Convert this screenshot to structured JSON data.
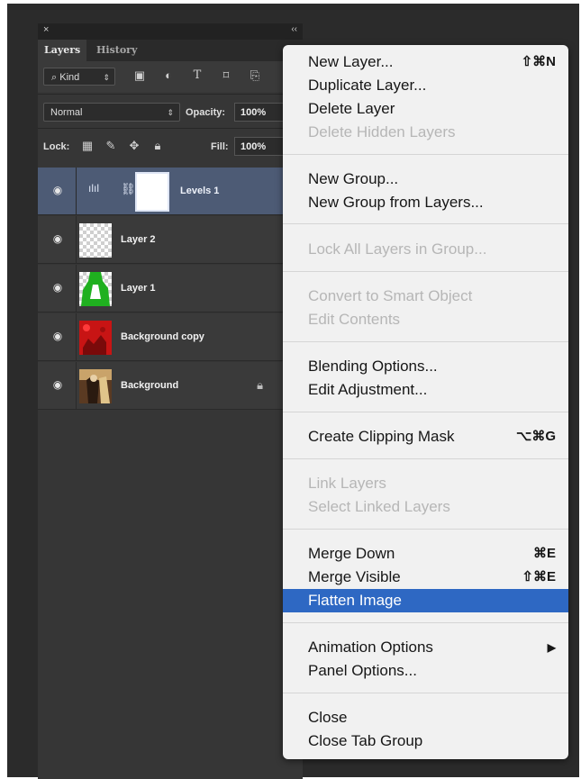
{
  "panel": {
    "close_glyph": "×",
    "collapse_glyph": "‹‹",
    "tabs": [
      {
        "label": "Layers",
        "active": true
      },
      {
        "label": "History",
        "active": false
      }
    ],
    "filter": {
      "kind_label": "Kind",
      "search_glyph": "⌕"
    },
    "blend_mode": "Normal",
    "opacity_label": "Opacity:",
    "opacity_value": "100%",
    "lock_label": "Lock:",
    "fill_label": "Fill:",
    "fill_value": "100%",
    "layers": [
      {
        "name": "Levels 1",
        "type": "adjustment",
        "selected": true,
        "visible": true
      },
      {
        "name": "Layer 2",
        "type": "transparent",
        "selected": false,
        "visible": true
      },
      {
        "name": "Layer 1",
        "type": "green",
        "selected": false,
        "visible": true
      },
      {
        "name": "Background copy",
        "type": "red",
        "selected": false,
        "visible": true
      },
      {
        "name": "Background",
        "type": "photo",
        "selected": false,
        "visible": true,
        "locked": true
      }
    ]
  },
  "menu": {
    "items": [
      {
        "label": "New Layer...",
        "shortcut": "⇧⌘N",
        "enabled": true
      },
      {
        "label": "Duplicate Layer...",
        "shortcut": "",
        "enabled": true
      },
      {
        "label": "Delete Layer",
        "shortcut": "",
        "enabled": true
      },
      {
        "label": "Delete Hidden Layers",
        "shortcut": "",
        "enabled": false
      },
      {
        "label": "New Group...",
        "shortcut": "",
        "enabled": true
      },
      {
        "label": "New Group from Layers...",
        "shortcut": "",
        "enabled": true
      },
      {
        "label": "Lock All Layers in Group...",
        "shortcut": "",
        "enabled": false
      },
      {
        "label": "Convert to Smart Object",
        "shortcut": "",
        "enabled": false
      },
      {
        "label": "Edit Contents",
        "shortcut": "",
        "enabled": false
      },
      {
        "label": "Blending Options...",
        "shortcut": "",
        "enabled": true
      },
      {
        "label": "Edit Adjustment...",
        "shortcut": "",
        "enabled": true
      },
      {
        "label": "Create Clipping Mask",
        "shortcut": "⌥⌘G",
        "enabled": true
      },
      {
        "label": "Link Layers",
        "shortcut": "",
        "enabled": false
      },
      {
        "label": "Select Linked Layers",
        "shortcut": "",
        "enabled": false
      },
      {
        "label": "Merge Down",
        "shortcut": "⌘E",
        "enabled": true
      },
      {
        "label": "Merge Visible",
        "shortcut": "⇧⌘E",
        "enabled": true
      },
      {
        "label": "Flatten Image",
        "shortcut": "",
        "enabled": true,
        "highlighted": true
      },
      {
        "label": "Animation Options",
        "shortcut": "▶",
        "enabled": true
      },
      {
        "label": "Panel Options...",
        "shortcut": "",
        "enabled": true
      },
      {
        "label": "Close",
        "shortcut": "",
        "enabled": true
      },
      {
        "label": "Close Tab Group",
        "shortcut": "",
        "enabled": true
      }
    ]
  },
  "colors": {
    "highlight": "#2e68c3",
    "selected_layer": "#4d5b75",
    "panel_bg": "#363636",
    "menu_bg": "#f1f1f1"
  }
}
